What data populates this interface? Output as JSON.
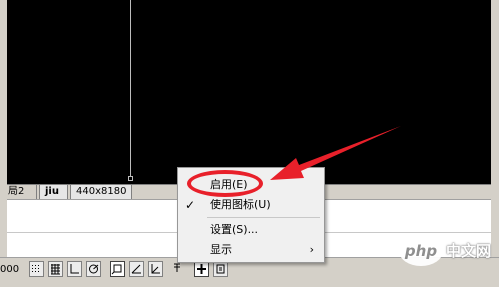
{
  "layout_tabs": [
    "局2",
    "jiu",
    "440x8180"
  ],
  "status_bar": {
    "coordinates": "000"
  },
  "context_menu": {
    "items": [
      {
        "label": "启用(E)",
        "checked": false
      },
      {
        "label": "使用图标(U)",
        "checked": true
      },
      {
        "label": "设置(S)...",
        "checked": false
      },
      {
        "label": "显示",
        "checked": false,
        "submenu": true
      }
    ],
    "check_mark": "✓",
    "submenu_arrow": "›"
  },
  "annotation": {
    "color": "#e8202a"
  },
  "watermark": {
    "logo": "php",
    "text": "中文网"
  },
  "icons": [
    "cursor-crosshair-icon",
    "snap-icon",
    "grid-icon",
    "ortho-icon",
    "polar-icon",
    "object-snap-icon",
    "otrack-icon",
    "ducs-icon",
    "dyn-icon",
    "lineweight-icon",
    "quick-properties-icon"
  ]
}
